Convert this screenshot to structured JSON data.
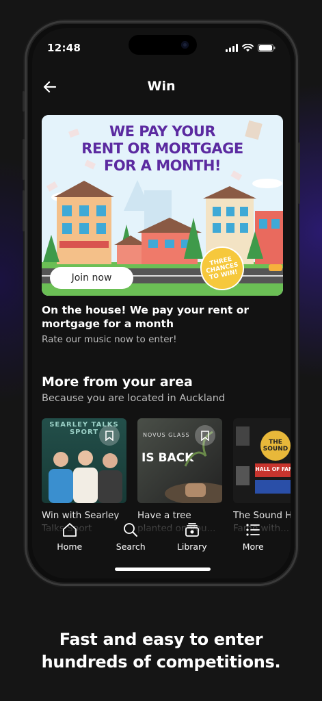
{
  "status": {
    "time": "12:48"
  },
  "header": {
    "title": "Win"
  },
  "promo": {
    "banner_headline": [
      "WE PAY YOUR",
      "RENT OR MORTGAGE",
      "FOR A MONTH!"
    ],
    "sticker_lines": [
      "THREE",
      "CHANCES",
      "TO WIN!"
    ],
    "join_label": "Join now",
    "title": "On the house! We pay your rent or mortgage for a month",
    "subtitle": "Rate our music now to enter!"
  },
  "section": {
    "title": "More from your area",
    "subtitle": "Because you are located in Auckland",
    "cards": [
      {
        "title": "Win with Searley Talks Sport",
        "thumb_text": "SEARLEY TALKS SPORT",
        "thumb_color": "#1f4a45"
      },
      {
        "title": "Have a tree planted on you...",
        "thumb_text": "IS BACK",
        "thumb_kicker": "NOVUS GLASS",
        "thumb_color": "#3a3f3a"
      },
      {
        "title": "The Sound Hall Of Fame with...",
        "thumb_text": "HALL OF FAME",
        "thumb_kicker": "THE SOUND",
        "thumb_color": "#1d1d1d"
      }
    ]
  },
  "tabs": [
    {
      "label": "Home",
      "icon": "home-icon"
    },
    {
      "label": "Search",
      "icon": "search-icon"
    },
    {
      "label": "Library",
      "icon": "library-icon"
    },
    {
      "label": "More",
      "icon": "more-icon"
    }
  ],
  "tagline": [
    "Fast and easy to enter",
    "hundreds of competitions."
  ],
  "colors": {
    "banner_headline": "#5b2aa0",
    "background": "#151515",
    "screen": "#121212"
  }
}
